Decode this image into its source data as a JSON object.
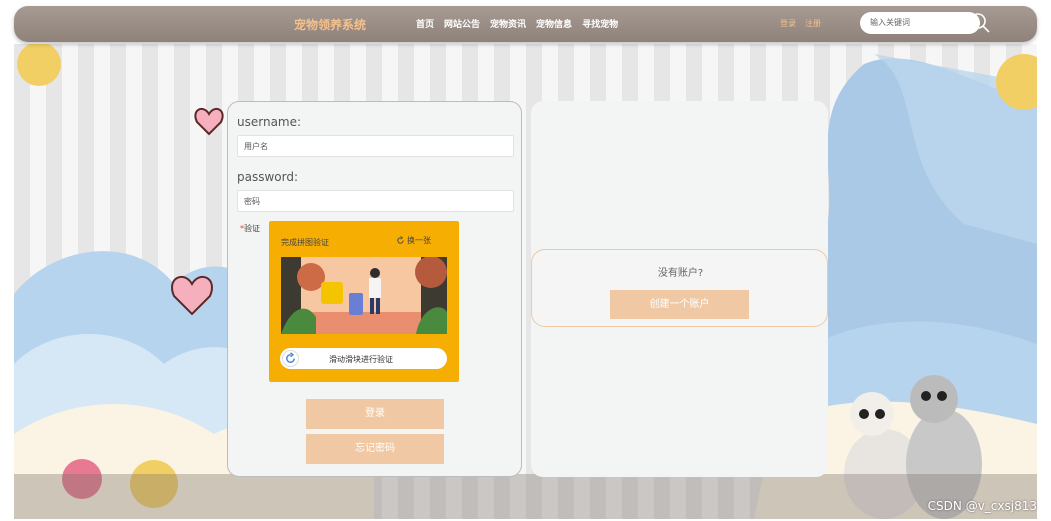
{
  "header": {
    "brand": "宠物领养系统",
    "nav": [
      "首页",
      "网站公告",
      "宠物资讯",
      "宠物信息",
      "寻找宠物"
    ],
    "login_link": "登录",
    "register_link": "注册",
    "search_placeholder": "输入关键词"
  },
  "login": {
    "username_label": "username:",
    "username_placeholder": "用户名",
    "password_label": "password:",
    "password_placeholder": "密码",
    "verify_required": "*",
    "verify_label": "验证",
    "captcha_title": "完成拼图验证",
    "captcha_refresh": "换一张",
    "slider_text": "滑动滑块进行验证",
    "login_button": "登录",
    "forgot_button": "忘记密码"
  },
  "signup": {
    "prompt": "没有账户?",
    "create_button": "创建一个账户"
  },
  "watermark": "CSDN @v_cxsj813",
  "colors": {
    "topbar": "#9a8e86",
    "brand": "#f5c08a",
    "button": "#f0c9a4",
    "captcha": "#f7ae02"
  }
}
